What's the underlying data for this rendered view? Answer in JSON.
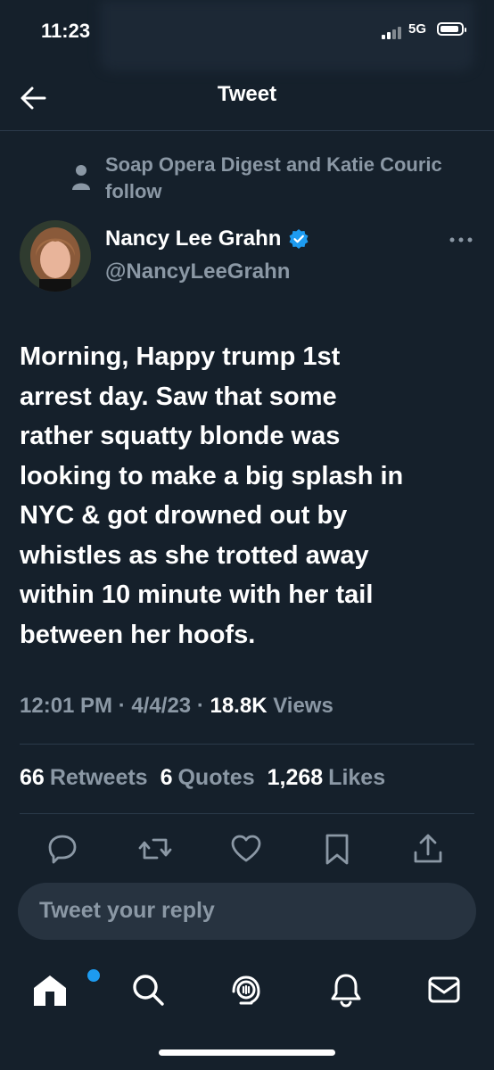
{
  "status_bar": {
    "time": "11:23",
    "network": "5G"
  },
  "header": {
    "title": "Tweet"
  },
  "social_context": {
    "text": "Soap Opera Digest and Katie Couric follow"
  },
  "author": {
    "display_name": "Nancy Lee Grahn",
    "handle": "@NancyLeeGrahn",
    "verified": true
  },
  "tweet": {
    "text": "Morning, Happy trump 1st\narrest day. Saw that some\nrather squatty blonde was\nlooking to make a big splash in\nNYC & got drowned out by\nwhistles as she trotted away\nwithin 10 minute with her tail\nbetween her hoofs.",
    "time": "12:01 PM",
    "date": "4/4/23",
    "separator": "·",
    "views_count": "18.8K",
    "views_label": "Views"
  },
  "stats": {
    "retweets_count": "66",
    "retweets_label": "Retweets",
    "quotes_count": "6",
    "quotes_label": "Quotes",
    "likes_count": "1,268",
    "likes_label": "Likes"
  },
  "actions": [
    "reply-icon",
    "retweet-icon",
    "like-icon",
    "bookmark-icon",
    "share-icon"
  ],
  "reply": {
    "placeholder": "Tweet your reply"
  },
  "nav": {
    "items": [
      "home-icon",
      "search-icon",
      "spaces-icon",
      "notifications-icon",
      "messages-icon"
    ],
    "badge_color": "#1d9bf0"
  },
  "colors": {
    "background": "#15202b",
    "secondary_text": "#8b98a5",
    "accent": "#1d9bf0"
  }
}
